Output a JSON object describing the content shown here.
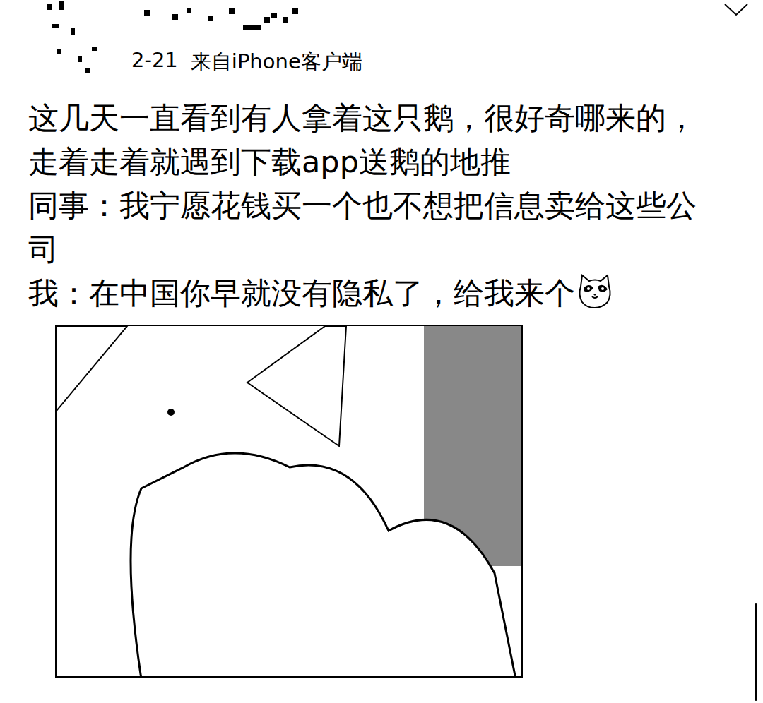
{
  "post": {
    "date": "2-21",
    "source": "来自iPhone客户端",
    "lines": [
      "这几天一直看到有人拿着这只鹅，很好奇哪来的，走着走着就遇到下载app送鹅的地推",
      "同事：我宁愿花钱买一个也不想把信息卖给这些公司",
      "我：在中国你早就没有隐私了，给我来个"
    ]
  }
}
